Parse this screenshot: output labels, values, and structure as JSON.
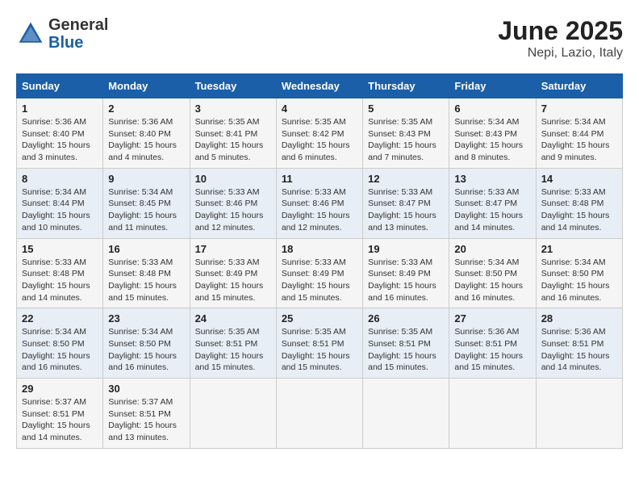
{
  "logo": {
    "general": "General",
    "blue": "Blue"
  },
  "title": "June 2025",
  "subtitle": "Nepi, Lazio, Italy",
  "weekdays": [
    "Sunday",
    "Monday",
    "Tuesday",
    "Wednesday",
    "Thursday",
    "Friday",
    "Saturday"
  ],
  "weeks": [
    [
      {
        "day": "1",
        "info": "Sunrise: 5:36 AM\nSunset: 8:40 PM\nDaylight: 15 hours\nand 3 minutes."
      },
      {
        "day": "2",
        "info": "Sunrise: 5:36 AM\nSunset: 8:40 PM\nDaylight: 15 hours\nand 4 minutes."
      },
      {
        "day": "3",
        "info": "Sunrise: 5:35 AM\nSunset: 8:41 PM\nDaylight: 15 hours\nand 5 minutes."
      },
      {
        "day": "4",
        "info": "Sunrise: 5:35 AM\nSunset: 8:42 PM\nDaylight: 15 hours\nand 6 minutes."
      },
      {
        "day": "5",
        "info": "Sunrise: 5:35 AM\nSunset: 8:43 PM\nDaylight: 15 hours\nand 7 minutes."
      },
      {
        "day": "6",
        "info": "Sunrise: 5:34 AM\nSunset: 8:43 PM\nDaylight: 15 hours\nand 8 minutes."
      },
      {
        "day": "7",
        "info": "Sunrise: 5:34 AM\nSunset: 8:44 PM\nDaylight: 15 hours\nand 9 minutes."
      }
    ],
    [
      {
        "day": "8",
        "info": "Sunrise: 5:34 AM\nSunset: 8:44 PM\nDaylight: 15 hours\nand 10 minutes."
      },
      {
        "day": "9",
        "info": "Sunrise: 5:34 AM\nSunset: 8:45 PM\nDaylight: 15 hours\nand 11 minutes."
      },
      {
        "day": "10",
        "info": "Sunrise: 5:33 AM\nSunset: 8:46 PM\nDaylight: 15 hours\nand 12 minutes."
      },
      {
        "day": "11",
        "info": "Sunrise: 5:33 AM\nSunset: 8:46 PM\nDaylight: 15 hours\nand 12 minutes."
      },
      {
        "day": "12",
        "info": "Sunrise: 5:33 AM\nSunset: 8:47 PM\nDaylight: 15 hours\nand 13 minutes."
      },
      {
        "day": "13",
        "info": "Sunrise: 5:33 AM\nSunset: 8:47 PM\nDaylight: 15 hours\nand 14 minutes."
      },
      {
        "day": "14",
        "info": "Sunrise: 5:33 AM\nSunset: 8:48 PM\nDaylight: 15 hours\nand 14 minutes."
      }
    ],
    [
      {
        "day": "15",
        "info": "Sunrise: 5:33 AM\nSunset: 8:48 PM\nDaylight: 15 hours\nand 14 minutes."
      },
      {
        "day": "16",
        "info": "Sunrise: 5:33 AM\nSunset: 8:48 PM\nDaylight: 15 hours\nand 15 minutes."
      },
      {
        "day": "17",
        "info": "Sunrise: 5:33 AM\nSunset: 8:49 PM\nDaylight: 15 hours\nand 15 minutes."
      },
      {
        "day": "18",
        "info": "Sunrise: 5:33 AM\nSunset: 8:49 PM\nDaylight: 15 hours\nand 15 minutes."
      },
      {
        "day": "19",
        "info": "Sunrise: 5:33 AM\nSunset: 8:49 PM\nDaylight: 15 hours\nand 16 minutes."
      },
      {
        "day": "20",
        "info": "Sunrise: 5:34 AM\nSunset: 8:50 PM\nDaylight: 15 hours\nand 16 minutes."
      },
      {
        "day": "21",
        "info": "Sunrise: 5:34 AM\nSunset: 8:50 PM\nDaylight: 15 hours\nand 16 minutes."
      }
    ],
    [
      {
        "day": "22",
        "info": "Sunrise: 5:34 AM\nSunset: 8:50 PM\nDaylight: 15 hours\nand 16 minutes."
      },
      {
        "day": "23",
        "info": "Sunrise: 5:34 AM\nSunset: 8:50 PM\nDaylight: 15 hours\nand 16 minutes."
      },
      {
        "day": "24",
        "info": "Sunrise: 5:35 AM\nSunset: 8:51 PM\nDaylight: 15 hours\nand 15 minutes."
      },
      {
        "day": "25",
        "info": "Sunrise: 5:35 AM\nSunset: 8:51 PM\nDaylight: 15 hours\nand 15 minutes."
      },
      {
        "day": "26",
        "info": "Sunrise: 5:35 AM\nSunset: 8:51 PM\nDaylight: 15 hours\nand 15 minutes."
      },
      {
        "day": "27",
        "info": "Sunrise: 5:36 AM\nSunset: 8:51 PM\nDaylight: 15 hours\nand 15 minutes."
      },
      {
        "day": "28",
        "info": "Sunrise: 5:36 AM\nSunset: 8:51 PM\nDaylight: 15 hours\nand 14 minutes."
      }
    ],
    [
      {
        "day": "29",
        "info": "Sunrise: 5:37 AM\nSunset: 8:51 PM\nDaylight: 15 hours\nand 14 minutes."
      },
      {
        "day": "30",
        "info": "Sunrise: 5:37 AM\nSunset: 8:51 PM\nDaylight: 15 hours\nand 13 minutes."
      },
      {
        "day": "",
        "info": ""
      },
      {
        "day": "",
        "info": ""
      },
      {
        "day": "",
        "info": ""
      },
      {
        "day": "",
        "info": ""
      },
      {
        "day": "",
        "info": ""
      }
    ]
  ]
}
